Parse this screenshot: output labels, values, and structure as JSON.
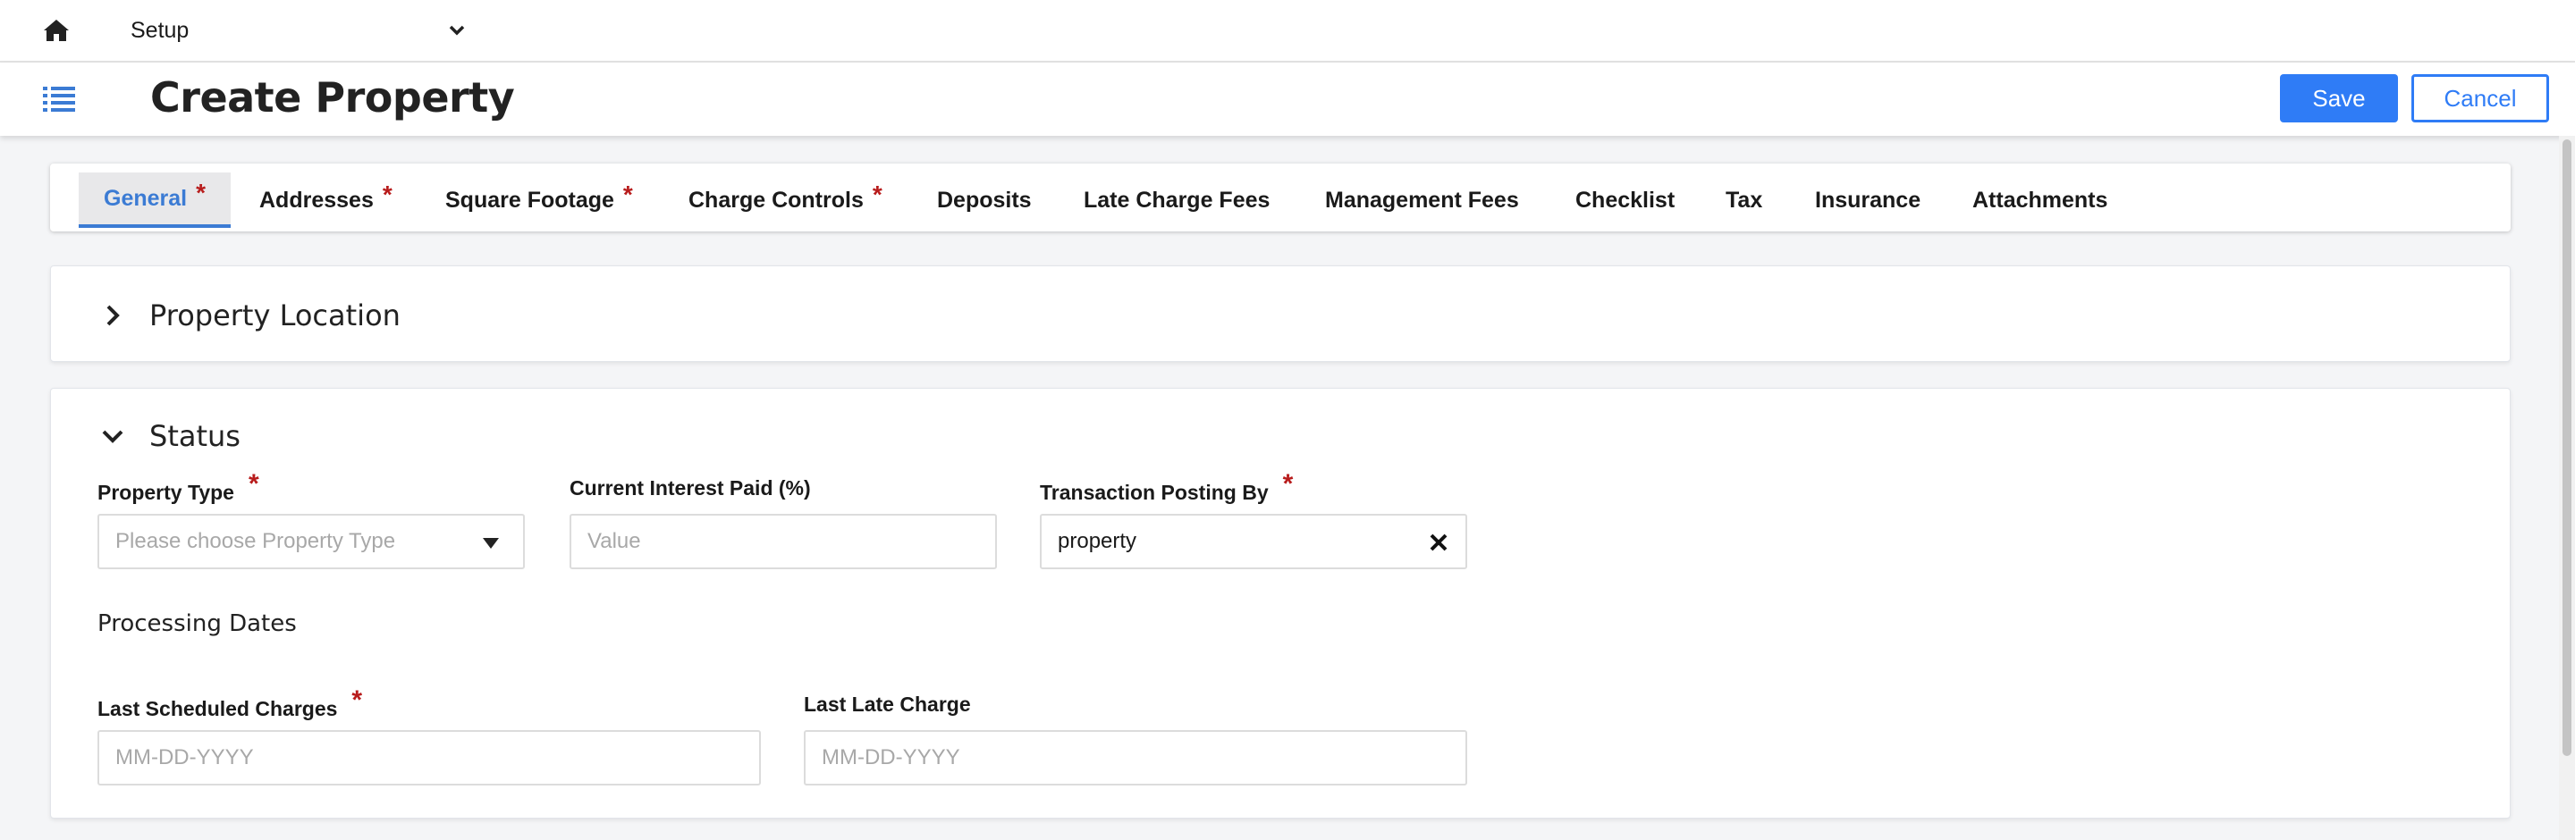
{
  "topbar": {
    "home_icon": "home-icon",
    "module": "Setup",
    "module_icon": "chevron-down-icon"
  },
  "header": {
    "menu_icon": "list-icon",
    "title": "Create Property",
    "save_label": "Save",
    "cancel_label": "Cancel"
  },
  "tabs": [
    {
      "label": "General",
      "required": true,
      "active": true
    },
    {
      "label": "Addresses",
      "required": true
    },
    {
      "label": "Square Footage",
      "required": true
    },
    {
      "label": "Charge Controls",
      "required": true
    },
    {
      "label": "Deposits"
    },
    {
      "label": "Late Charge Fees"
    },
    {
      "label": "Management Fees"
    },
    {
      "label": "Checklist"
    },
    {
      "label": "Tax"
    },
    {
      "label": "Insurance"
    },
    {
      "label": "Attachments"
    }
  ],
  "required_marker": "*",
  "sections": {
    "location": {
      "title": "Property Location",
      "expanded": false,
      "icon": "chevron-right-icon"
    },
    "status": {
      "title": "Status",
      "expanded": true,
      "icon": "chevron-down-icon"
    }
  },
  "status_form": {
    "property_type": {
      "label": "Property Type",
      "placeholder": "Please choose Property Type",
      "required": true
    },
    "current_interest": {
      "label": "Current Interest Paid (%)",
      "placeholder": "Value"
    },
    "transaction_posting": {
      "label": "Transaction Posting By",
      "value": "property",
      "required": true,
      "clear_icon": "close-icon"
    },
    "processing_dates_heading": "Processing Dates",
    "last_scheduled_charges": {
      "label": "Last Scheduled Charges",
      "placeholder": "MM-DD-YYYY",
      "required": true
    },
    "last_late_charge": {
      "label": "Last Late Charge",
      "placeholder": "MM-DD-YYYY"
    }
  },
  "colors": {
    "accent": "#2f7cf6",
    "active_tab": "#3b7bd4",
    "required": "#b81c1c",
    "background": "#f4f5f7"
  }
}
